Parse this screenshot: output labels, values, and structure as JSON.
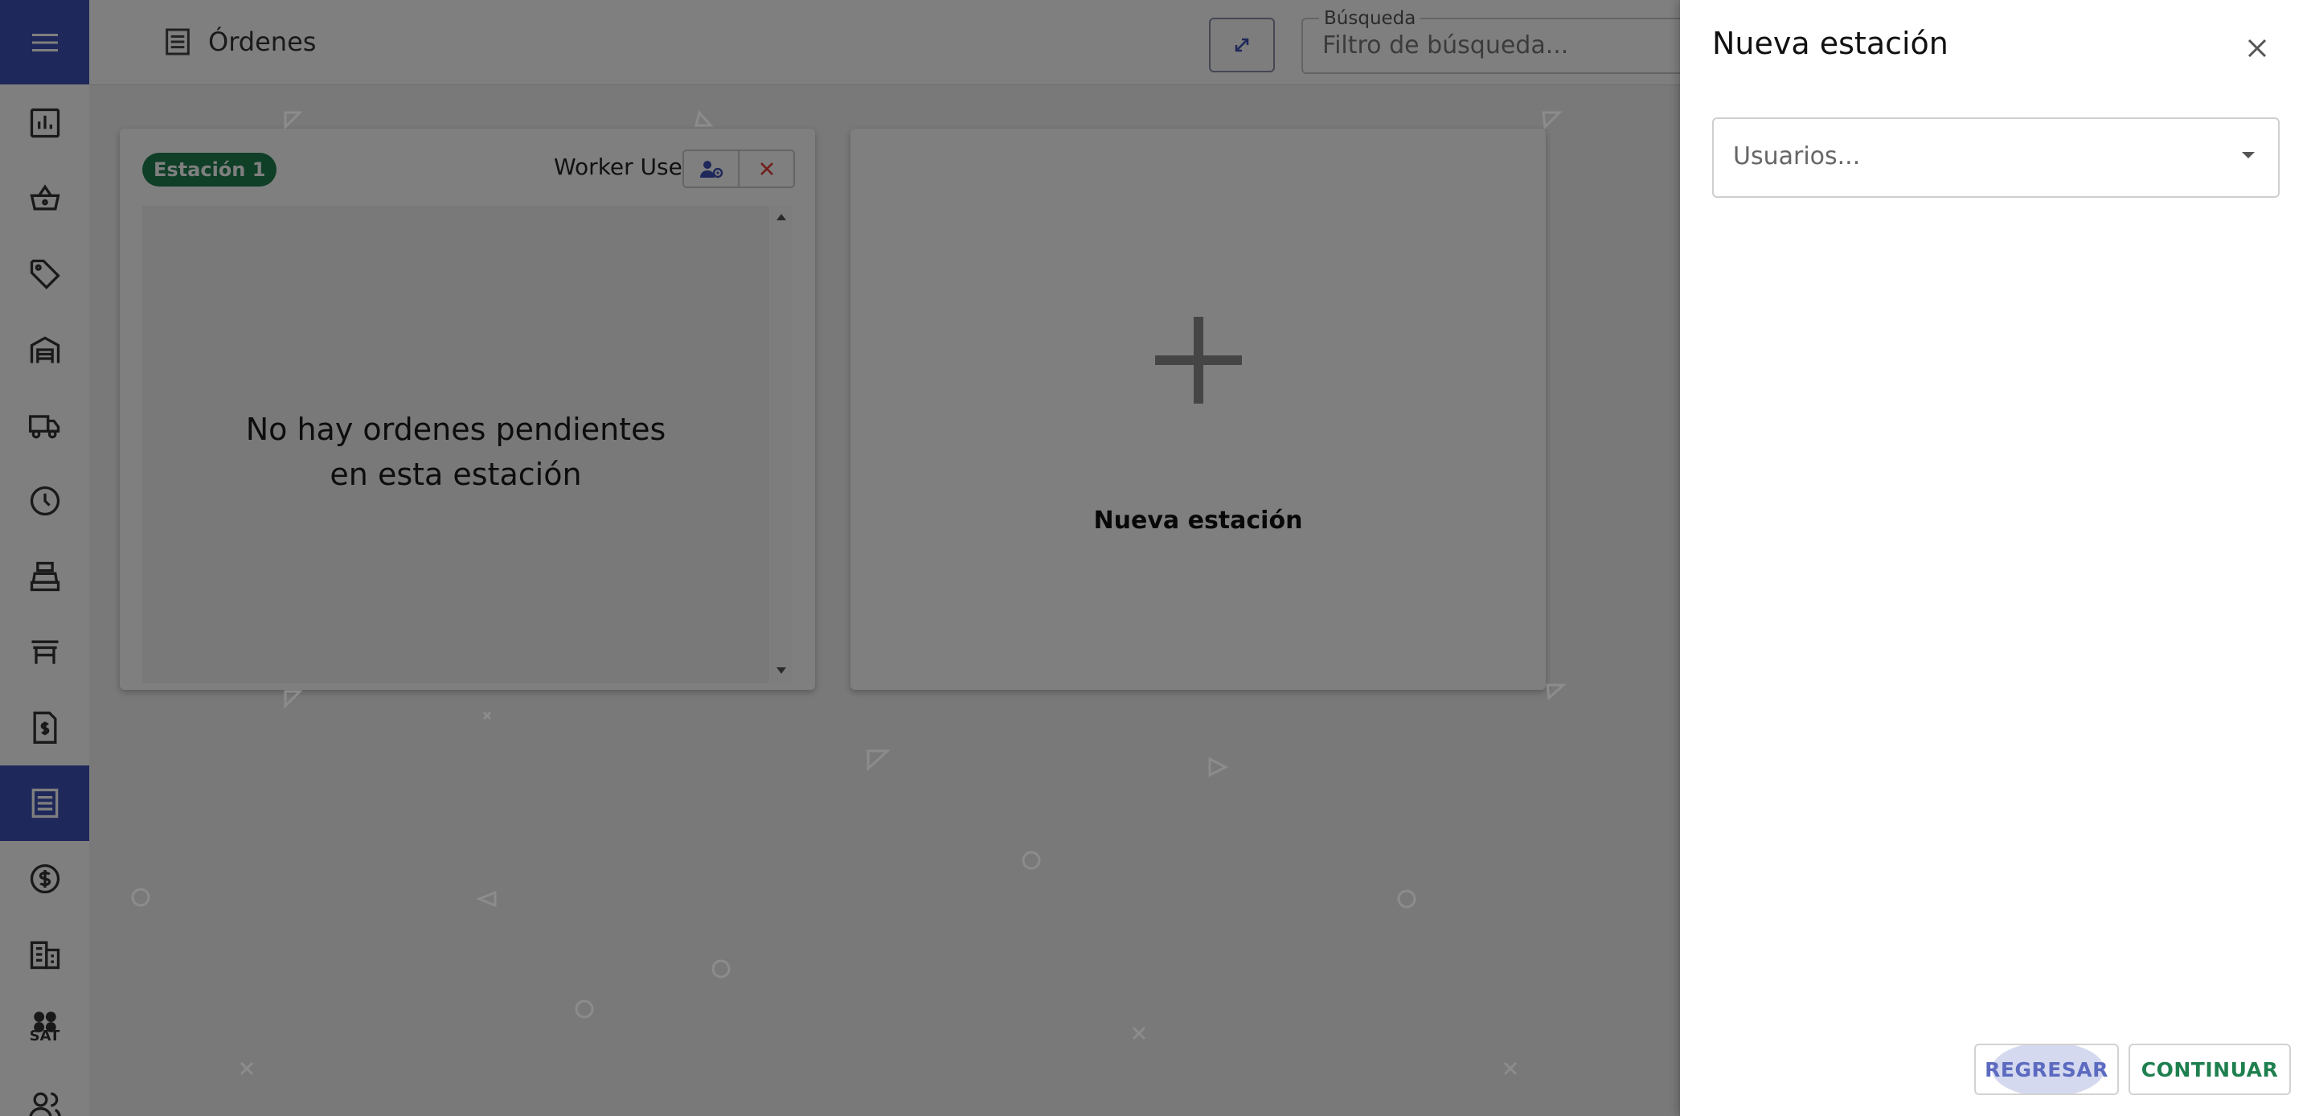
{
  "header": {
    "title": "Órdenes",
    "search": {
      "legend": "Búsqueda",
      "placeholder": "Filtro de búsqueda..."
    }
  },
  "sidebar": {
    "items": [
      {
        "icon": "bar-chart-icon"
      },
      {
        "icon": "basket-icon"
      },
      {
        "icon": "tag-icon"
      },
      {
        "icon": "warehouse-icon"
      },
      {
        "icon": "truck-icon"
      },
      {
        "icon": "clock-icon"
      },
      {
        "icon": "cashier-icon"
      },
      {
        "icon": "table-icon"
      },
      {
        "icon": "invoice-icon"
      },
      {
        "icon": "orders-icon",
        "active": true
      },
      {
        "icon": "dollar-icon"
      },
      {
        "icon": "building-icon"
      },
      {
        "icon": "sat-icon",
        "label": "SAT"
      },
      {
        "icon": "users-icon"
      }
    ]
  },
  "stations": [
    {
      "badge": "Estación 1",
      "worker": "Worker User",
      "empty_message_line1": "No hay ordenes pendientes",
      "empty_message_line2": "en esta estación"
    }
  ],
  "new_station_card": {
    "label": "Nueva estación"
  },
  "drawer": {
    "title": "Nueva estación",
    "users_placeholder": "Usuarios...",
    "back_label": "REGRESAR",
    "continue_label": "CONTINUAR"
  },
  "colors": {
    "primary": "#3f51b5",
    "badge_green": "#1e7f4f",
    "continue_green": "#1e7f4f",
    "close_red": "#e53935"
  }
}
